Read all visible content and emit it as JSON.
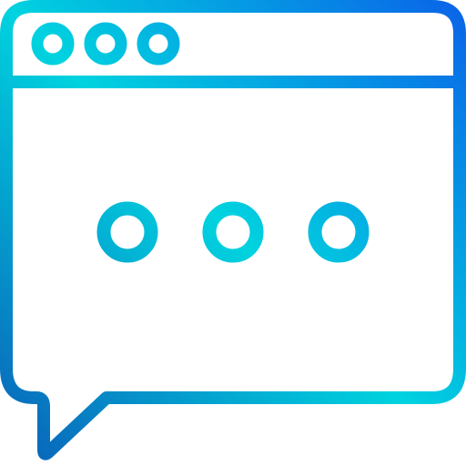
{
  "icon": {
    "name": "browser-chat-bubble-icon",
    "style": "gradient outline",
    "gradient_colors": [
      "#0a5db8",
      "#00d3df",
      "#0a62e8"
    ],
    "window_control_dots": 3,
    "typing_dots": 3
  }
}
